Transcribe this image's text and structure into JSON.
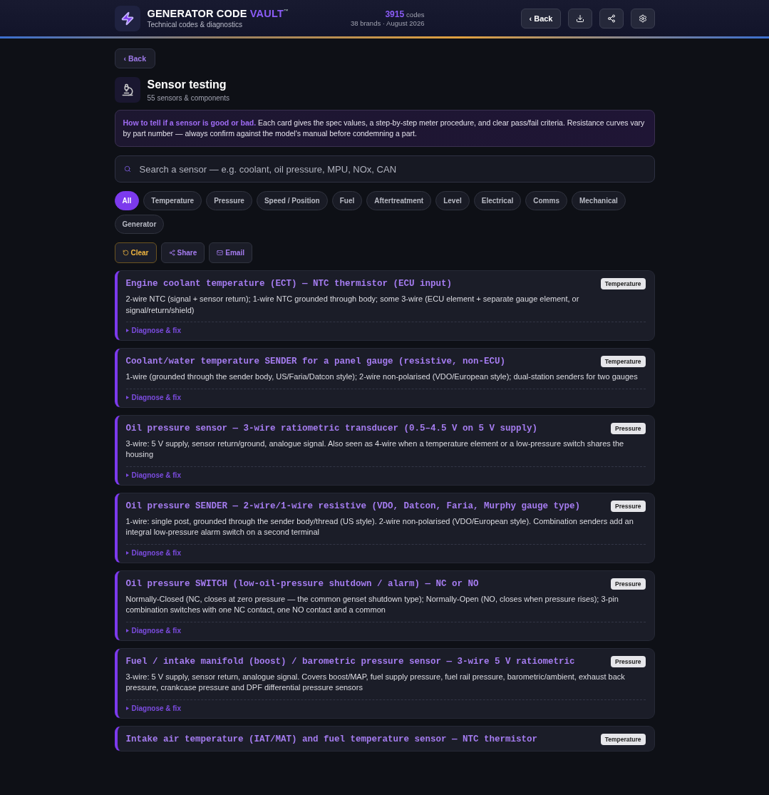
{
  "header": {
    "brand": "GENERATOR CODE",
    "brand_accent": "VAULT",
    "trademark": "™",
    "tagline": "Technical codes & diagnostics",
    "code_count": "3915",
    "code_label": "codes",
    "meta": "38 brands · August 2026",
    "back_label": "‹ Back"
  },
  "back_label": "‹ Back",
  "page": {
    "title": "Sensor testing",
    "subtitle": "55 sensors & components"
  },
  "notice": "**How to tell if a sensor is good or bad.** Each card gives the spec values, a step-by-step meter procedure, and clear pass/fail criteria. Resistance curves vary by part number — always confirm against the model's manual before condemning a part.",
  "search": {
    "placeholder": "Search a sensor — e.g. coolant, oil pressure, MPU, NOx, CAN"
  },
  "filters": [
    {
      "label": "All",
      "selected": true
    },
    {
      "label": "Temperature",
      "selected": false
    },
    {
      "label": "Pressure",
      "selected": false
    },
    {
      "label": "Speed / Position",
      "selected": false
    },
    {
      "label": "Fuel",
      "selected": false
    },
    {
      "label": "Aftertreatment",
      "selected": false
    },
    {
      "label": "Level",
      "selected": false
    },
    {
      "label": "Electrical",
      "selected": false
    },
    {
      "label": "Comms",
      "selected": false
    },
    {
      "label": "Mechanical",
      "selected": false
    },
    {
      "label": "Generator",
      "selected": false
    }
  ],
  "actions": [
    {
      "kind": "clear",
      "label": "Clear"
    },
    {
      "kind": "share",
      "label": "Share"
    },
    {
      "kind": "email",
      "label": "Email"
    }
  ],
  "sensors": [
    {
      "title": "Engine coolant temperature (ECT) — NTC thermistor (ECU input)",
      "tag": "Temperature",
      "wiring": "2-wire NTC (signal + sensor return); 1-wire NTC grounded through body; some 3-wire (ECU element + separate gauge element, or signal/return/shield)",
      "toggle": "Diagnose & fix"
    },
    {
      "title": "Coolant/water temperature SENDER for a panel gauge (resistive, non-ECU)",
      "tag": "Temperature",
      "wiring": "1-wire (grounded through the sender body, US/Faria/Datcon style); 2-wire non-polarised (VDO/European style); dual-station senders for two gauges",
      "toggle": "Diagnose & fix"
    },
    {
      "title": "Oil pressure sensor — 3-wire ratiometric transducer (0.5–4.5 V on 5 V supply)",
      "tag": "Pressure",
      "wiring": "3-wire: 5 V supply, sensor return/ground, analogue signal. Also seen as 4-wire when a temperature element or a low-pressure switch shares the housing",
      "toggle": "Diagnose & fix"
    },
    {
      "title": "Oil pressure SENDER — 2-wire/1-wire resistive (VDO, Datcon, Faria, Murphy gauge type)",
      "tag": "Pressure",
      "wiring": "1-wire: single post, grounded through the sender body/thread (US style). 2-wire non-polarised (VDO/European style). Combination senders add an integral low-pressure alarm switch on a second terminal",
      "toggle": "Diagnose & fix"
    },
    {
      "title": "Oil pressure SWITCH (low-oil-pressure shutdown / alarm) — NC or NO",
      "tag": "Pressure",
      "wiring": "Normally-Closed (NC, closes at zero pressure — the common genset shutdown type); Normally-Open (NO, closes when pressure rises); 3-pin combination switches with one NC contact, one NO contact and a common",
      "toggle": "Diagnose & fix"
    },
    {
      "title": "Fuel / intake manifold (boost) / barometric pressure sensor — 3-wire 5 V ratiometric",
      "tag": "Pressure",
      "wiring": "3-wire: 5 V supply, sensor return, analogue signal. Covers boost/MAP, fuel supply pressure, fuel rail pressure, barometric/ambient, exhaust back pressure, crankcase pressure and DPF differential pressure sensors",
      "toggle": "Diagnose & fix"
    },
    {
      "title": "Intake air temperature (IAT/MAT) and fuel temperature sensor — NTC thermistor",
      "tag": "Temperature"
    }
  ]
}
